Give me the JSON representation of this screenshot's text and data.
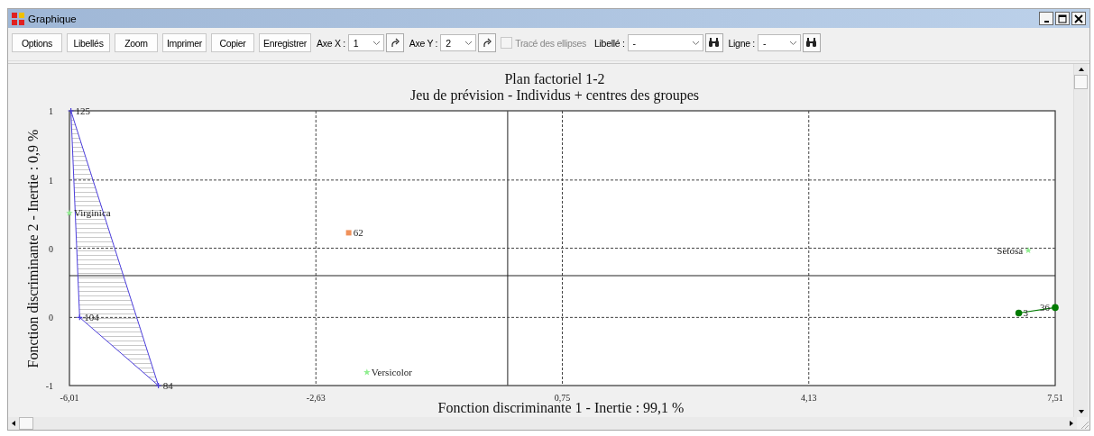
{
  "window": {
    "title": "Graphique"
  },
  "toolbar": {
    "buttons": [
      "Options",
      "Libellés",
      "Zoom",
      "Imprimer",
      "Copier",
      "Enregistrer"
    ],
    "axis_x": {
      "label": "Axe X :",
      "value": "1"
    },
    "axis_y": {
      "label": "Axe Y :",
      "value": "2"
    },
    "ellipses": {
      "label": "Tracé des ellipses",
      "checked": false,
      "disabled": true
    },
    "label_search": {
      "label": "Libellé :",
      "value": "-"
    },
    "line_search": {
      "label": "Ligne :",
      "value": "-"
    }
  },
  "chart": {
    "subtitle": "Jeu de prévision - Individus + centres des groupes",
    "series_styles": [
      {
        "hull": true,
        "connected": false
      },
      {
        "hull": false,
        "connected": false
      },
      {
        "hull": false,
        "connected": true
      },
      {
        "hull": false,
        "connected": false
      }
    ],
    "chart_data": {
      "type": "scatter",
      "title": "Plan factoriel 1-2",
      "grid": true,
      "xlabel": "Fonction discriminante 1 - Inertie : 99,1 %",
      "ylabel": "Fonction discriminante 2 - Inertie : 0,9 %",
      "xlim": [
        -6.01,
        7.51
      ],
      "ylim": [
        -1,
        1.5
      ],
      "xticks": [
        {
          "value": -6.01,
          "label": "-6,01"
        },
        {
          "value": -2.63,
          "label": "-2,63"
        },
        {
          "value": 0.75,
          "label": "0,75"
        },
        {
          "value": 4.13,
          "label": "4,13"
        },
        {
          "value": 7.51,
          "label": "7,51"
        }
      ],
      "yticks": [
        {
          "value": -1,
          "label": "-1"
        },
        {
          "value": -0.38,
          "label": "0"
        },
        {
          "value": 0.25,
          "label": "0"
        },
        {
          "value": 0.87,
          "label": "1"
        },
        {
          "value": 1.5,
          "label": "1"
        }
      ],
      "series": [
        {
          "marker": "cross",
          "color": "#4b3ddc",
          "x": [
            -5.99,
            -5.87,
            -4.79
          ],
          "values": [
            1.5,
            -0.38,
            -1
          ]
        },
        {
          "marker": "square",
          "color": "#f0915a",
          "x": [
            -2.18
          ],
          "values": [
            0.39
          ]
        },
        {
          "marker": "circle",
          "color": "#007a00",
          "x": [
            7.01,
            7.51
          ],
          "values": [
            -0.34,
            -0.29
          ]
        },
        {
          "marker": "star",
          "color": "#90ee90",
          "x": [
            -6.01,
            -1.93,
            7.14
          ],
          "values": [
            0.57,
            -0.88,
            0.23
          ]
        }
      ],
      "annotations": [
        {
          "x": -5.99,
          "y": 1.5,
          "text": "125"
        },
        {
          "x": -5.87,
          "y": -0.38,
          "text": "104"
        },
        {
          "x": -4.79,
          "y": -1,
          "text": "84"
        },
        {
          "x": -2.18,
          "y": 0.39,
          "text": "62"
        },
        {
          "x": 7.01,
          "y": -0.34,
          "text": "3"
        },
        {
          "x": 7.51,
          "y": -0.29,
          "text": "36"
        },
        {
          "x": -6.01,
          "y": 0.57,
          "text": "Virginica"
        },
        {
          "x": -1.93,
          "y": -0.88,
          "text": "Versicolor"
        },
        {
          "x": 7.14,
          "y": 0.23,
          "text": "Setosa"
        }
      ]
    }
  }
}
